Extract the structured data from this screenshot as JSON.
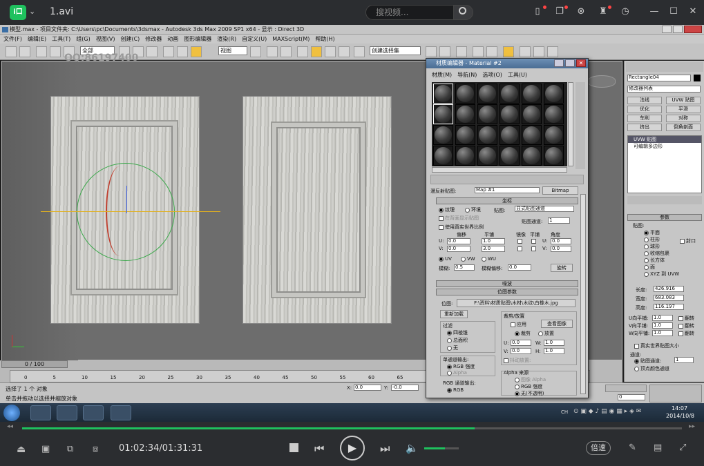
{
  "player": {
    "file_name": "1.avi",
    "search_placeholder": "搜视频...",
    "time": "01:02:34/01:31:31",
    "speed_label": "倍速",
    "progress": 0.686,
    "volume": 0.6
  },
  "max": {
    "title": "模型.max    - 项目文件夹: C:\\Users\\pc\\Documents\\3dsmax    - Autodesk 3ds Max  2009 SP1  x64     - 显示 : Direct 3D",
    "menus": [
      "文件(F)",
      "编辑(E)",
      "工具(T)",
      "组(G)",
      "视图(V)",
      "创建(C)",
      "修改器",
      "动画",
      "图形编辑器",
      "渲染(R)",
      "自定义(U)",
      "MAXScript(M)",
      "帮助(H)"
    ],
    "toolbar_select": "全部",
    "toolbar_view": "视图",
    "named_sel": "创建选择集",
    "viewport_label": "透视",
    "watermark": "QQ:86197400",
    "timeline_frame": "0 / 100",
    "ticks": [
      "0",
      "5",
      "10",
      "15",
      "20",
      "25",
      "30",
      "35",
      "40",
      "45",
      "50",
      "55",
      "60",
      "65",
      "70"
    ],
    "status1": "选择了 1 个 对象",
    "status2": "单击并拖动以选择并缩放对象",
    "coord_x": "0.0",
    "coord_y": "-0.0",
    "frame_val": "0",
    "right": {
      "obj_name": "Rectangle04",
      "mod_list": "修改器列表",
      "btns": [
        "法线",
        "UVW 贴图",
        "优化",
        "平滑",
        "车削",
        "对称",
        "挤出",
        "倒角剖面"
      ],
      "stack": [
        "UVW 贴图",
        "可编辑多边形"
      ],
      "params": "参数",
      "mapping": "贴图:",
      "types": [
        "平面",
        "柱形",
        "球形",
        "收缩包裹",
        "长方体",
        "面",
        "XYZ 到 UVW"
      ],
      "cap": "封口",
      "len_l": "长度:",
      "len": "426.916",
      "wid_l": "宽度:",
      "wid": "683.083",
      "hgt_l": "高度:",
      "hgt": "116.197",
      "tile_labels": [
        "U向平铺:",
        "V向平铺:",
        "W向平铺:"
      ],
      "tile": "1.0",
      "flip": "翻转",
      "real": "真实世界贴图大小",
      "chan": "通道:",
      "chan_opt": "贴图通道:",
      "chan_val": "1",
      "vc": "顶点颜色通道"
    }
  },
  "me": {
    "title": "材质编辑器 - Material #2",
    "menus": [
      "材质(M)",
      "导航(N)",
      "选项(O)",
      "工具(U)"
    ],
    "map_label": "漫反射贴图:",
    "map_name": "Map #1",
    "map_type": "Bitmap",
    "coords": "坐标",
    "tex": "纹理",
    "env": "环境",
    "mapping_l": "贴图:",
    "mapping": "显式贴图通道",
    "show_back": "在背面显示贴图",
    "map_chan": "贴图通道:",
    "map_chan_v": "1",
    "real": "使用真实世界比例",
    "cols": [
      "偏移",
      "平铺",
      "镜像",
      "平铺",
      "角度"
    ],
    "u": "U:",
    "v": "V:",
    "w": "W:",
    "zero": "0.0",
    "one": "1.0",
    "three": "3.0",
    "ang_w": "0.0",
    "uv": "UV",
    "vw": "VW",
    "wu": "WU",
    "blur_l": "模糊:",
    "blur": "0.5",
    "blur_off_l": "模糊偏移:",
    "blur_off": "0.0",
    "rotate": "旋转",
    "noise": "噪波",
    "bmp_params": "位图参数",
    "bitmap_l": "位图:",
    "bitmap_path": "F:\\资料\\材质贴图\\木材\\木纹\\白橡木.jpg",
    "reload": "重新加载",
    "filter": "过滤",
    "f1": "四棱锥",
    "f2": "总面积",
    "f3": "无",
    "crop": "裁剪/放置",
    "apply": "应用",
    "view_img": "查看图像",
    "crop_opt": "裁剪",
    "place": "放置",
    "cu": "U:",
    "cv": "V:",
    "cw": "W:",
    "ch": "H:",
    "c0": "0.0",
    "c1": "1.0",
    "jitter": "抖动放置:",
    "mono": "单通道输出:",
    "rgb_int": "RGB 强度",
    "alpha": "Alpha",
    "rgb_out": "RGB 通道输出:",
    "rgb": "RGB",
    "alpha_src": "Alpha 来源",
    "img_alpha": "图像 Alpha",
    "rgb_int2": "RGB 强度",
    "none_op": "无(不透明)"
  },
  "clock": {
    "time": "14:07",
    "date": "2014/10/8",
    "lang": "CH"
  }
}
